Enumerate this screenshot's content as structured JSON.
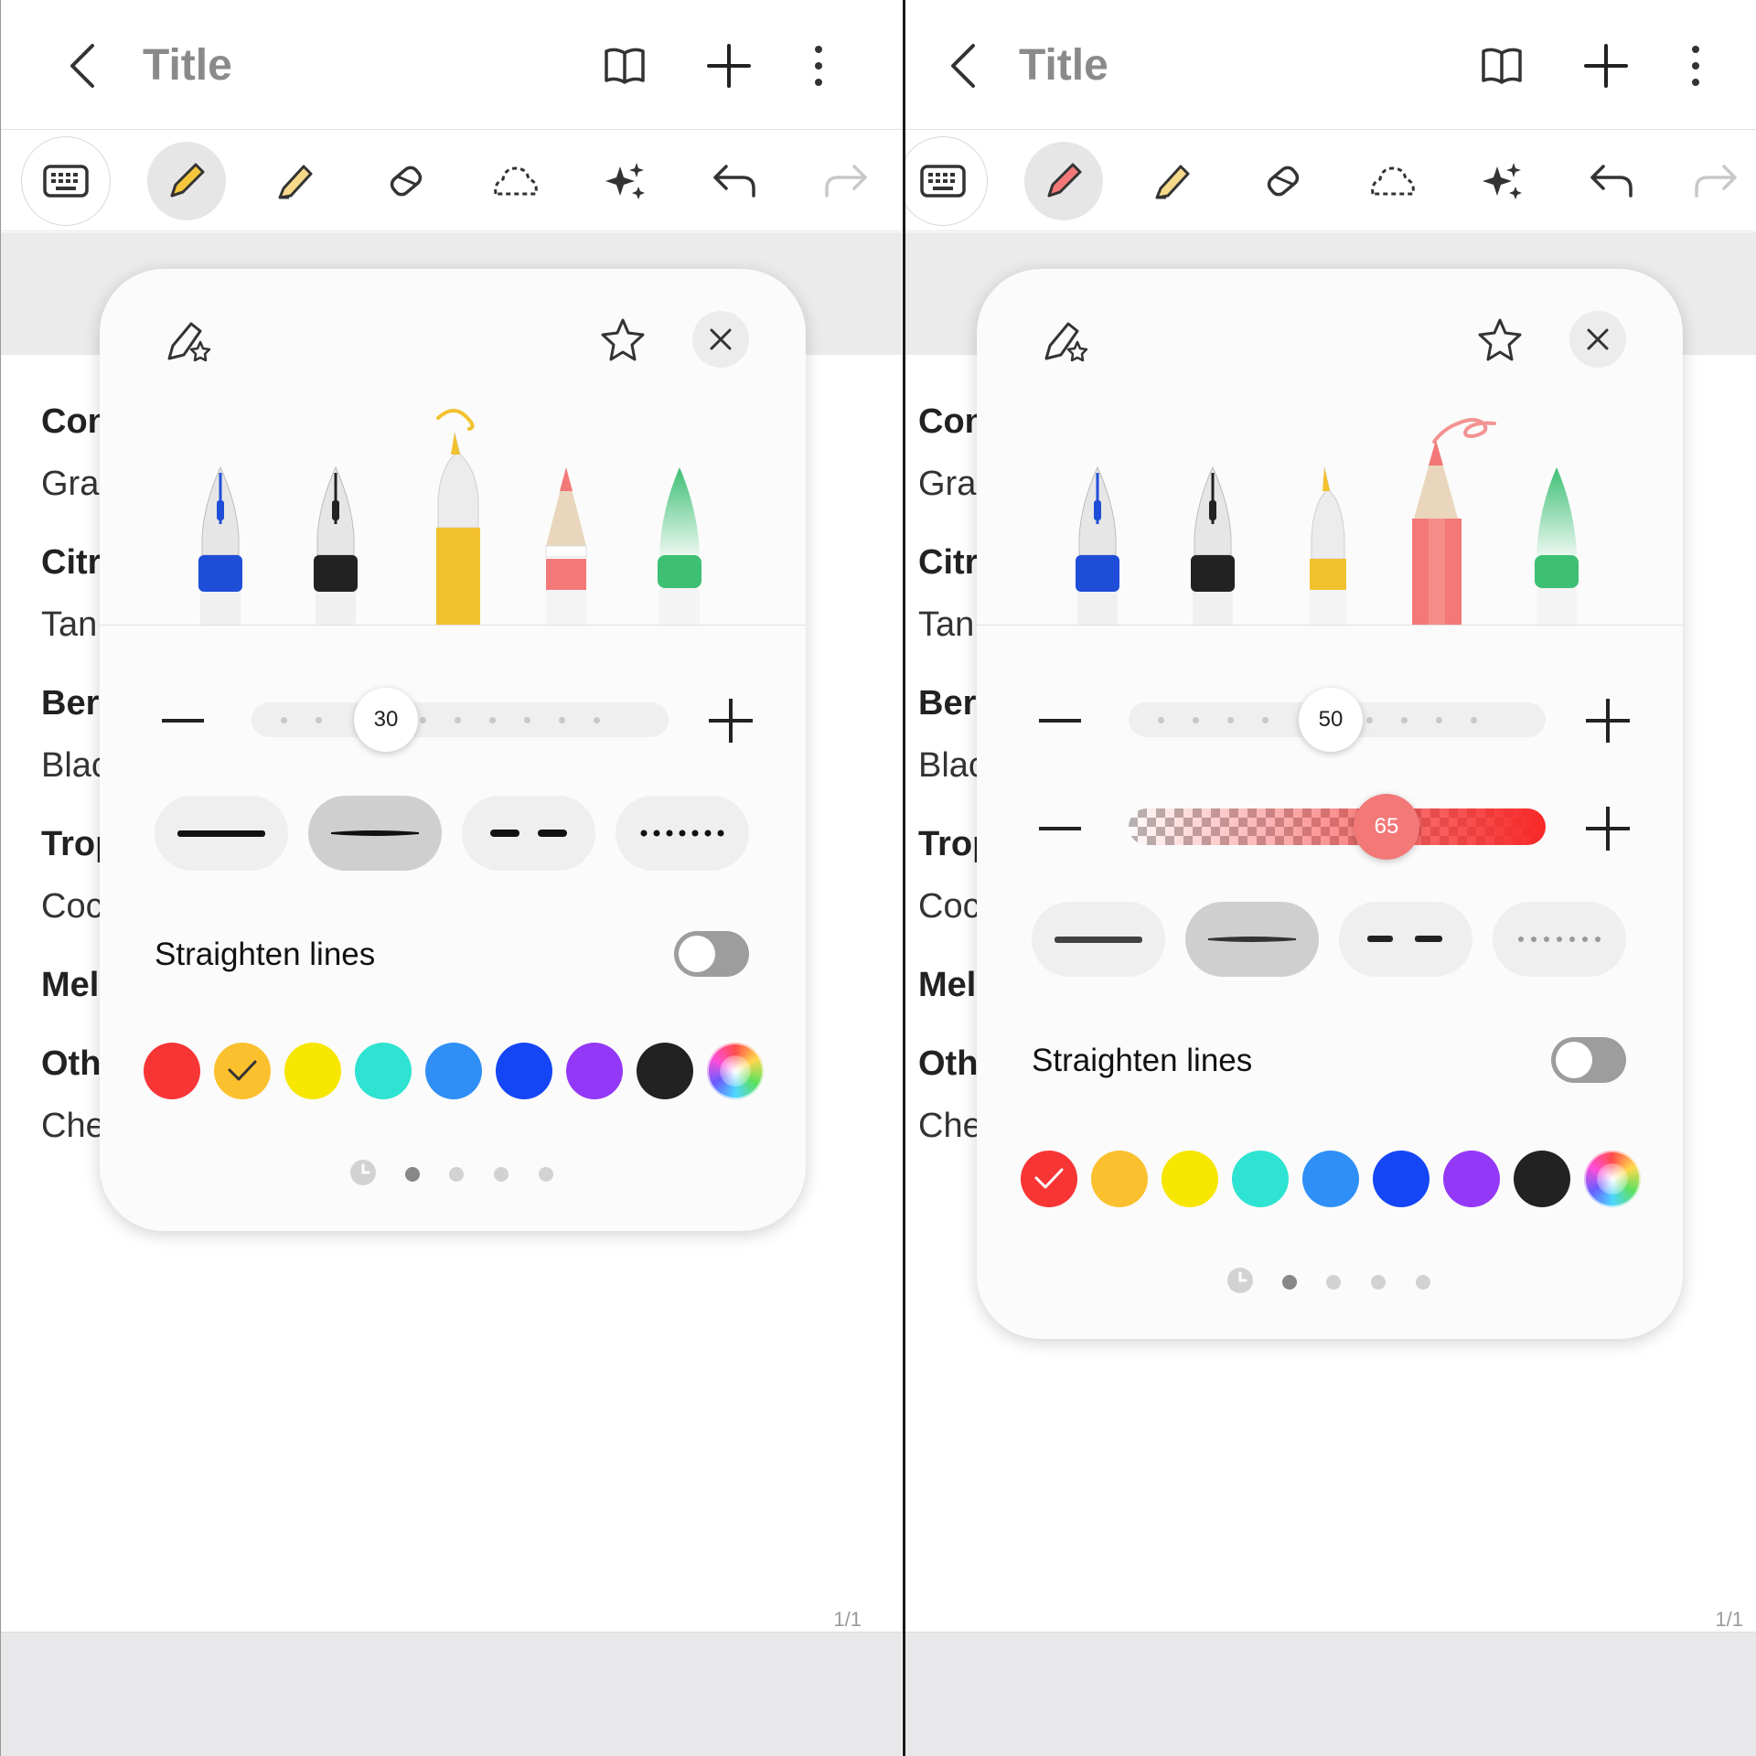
{
  "left_screen": {
    "header": {
      "title": "Title"
    },
    "document": {
      "lines": [
        "Con",
        "Gra",
        "Citr",
        "Tan",
        "Ber",
        "Blac",
        "Trop",
        "Coc",
        "Mel",
        "Oth",
        "Che"
      ],
      "page_indicator": "1/1"
    },
    "pen_panel": {
      "selected_pen": "ballpoint-pen",
      "selected_pen_color": "#f2c12e",
      "size_value": "30",
      "straighten_label": "Straighten lines",
      "straighten_enabled": false,
      "colors": [
        "#f73535",
        "#fbc02d",
        "#f7e600",
        "#2ee3d1",
        "#2f8ff7",
        "#1446f5",
        "#9438f7",
        "#222222",
        "color-wheel"
      ],
      "selected_color_index": 1,
      "pager_active_index": 0
    }
  },
  "right_screen": {
    "header": {
      "title": "Title"
    },
    "document": {
      "lines": [
        "Con",
        "Gra",
        "Citr",
        "Tan",
        "Ber",
        "Blac",
        "Trop",
        "Coc",
        "Mel",
        "Oth",
        "Che"
      ],
      "page_indicator": "1/1"
    },
    "pen_panel": {
      "selected_pen": "pencil",
      "selected_pen_color": "#f37a78",
      "size_value": "50",
      "opacity_value": "65",
      "straighten_label": "Straighten lines",
      "straighten_enabled": false,
      "colors": [
        "#f73535",
        "#fbc02d",
        "#f7e600",
        "#2ee3d1",
        "#2f8ff7",
        "#1446f5",
        "#9438f7",
        "#222222",
        "color-wheel"
      ],
      "selected_color_index": 0,
      "pager_active_index": 0
    }
  }
}
